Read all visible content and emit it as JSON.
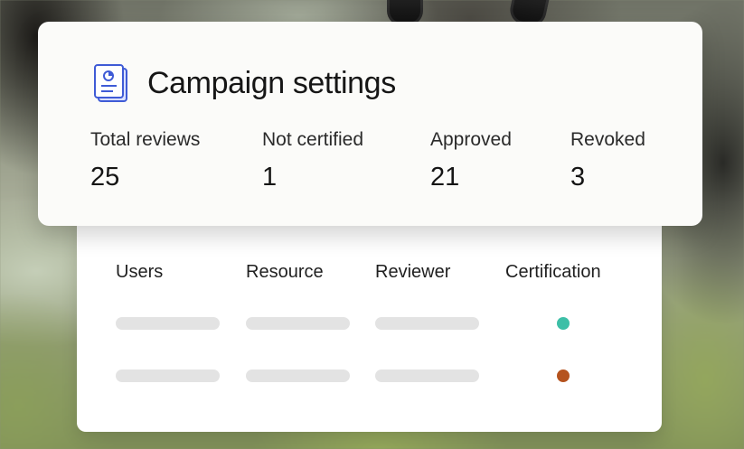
{
  "settings": {
    "title": "Campaign settings",
    "icon": "document-report-icon",
    "stats": [
      {
        "label": "Total reviews",
        "value": "25"
      },
      {
        "label": "Not certified",
        "value": "1"
      },
      {
        "label": "Approved",
        "value": "21"
      },
      {
        "label": "Revoked",
        "value": "3"
      }
    ]
  },
  "table": {
    "columns": [
      "Users",
      "Resource",
      "Reviewer",
      "Certification"
    ],
    "rows": [
      {
        "certification_color": "#3dbfa7"
      },
      {
        "certification_color": "#b5531e"
      }
    ]
  },
  "colors": {
    "accent_blue": "#3f5bd6",
    "certified_teal": "#3dbfa7",
    "revoked_rust": "#b5531e",
    "placeholder_gray": "#e3e3e3"
  }
}
